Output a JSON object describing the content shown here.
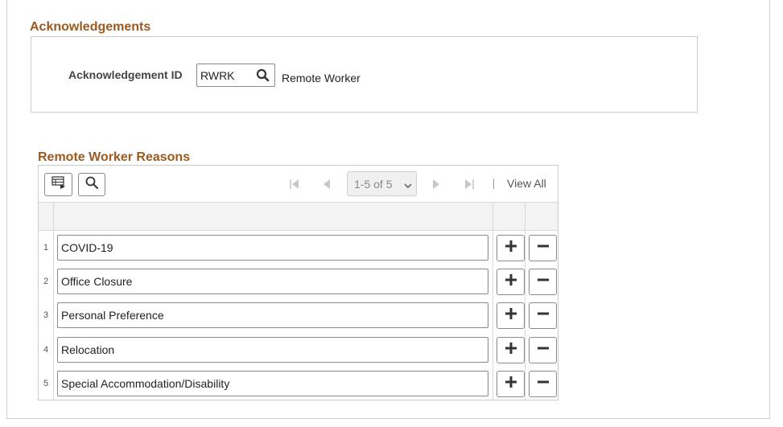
{
  "acknowledgements": {
    "section_title": "Acknowledgements",
    "id_label": "Acknowledgement ID",
    "id_value": "RWRK",
    "description": "Remote Worker"
  },
  "grid": {
    "title": "Remote Worker Reasons",
    "pagination": "1-5 of 5",
    "view_all": "View All",
    "rows": [
      {
        "num": "1",
        "value": "COVID-19"
      },
      {
        "num": "2",
        "value": "Office Closure"
      },
      {
        "num": "3",
        "value": "Personal Preference"
      },
      {
        "num": "4",
        "value": "Relocation"
      },
      {
        "num": "5",
        "value": "Special Accommodation/Disability"
      }
    ]
  },
  "colors": {
    "section_title": "#9c5a1f",
    "border": "#8a8a8a",
    "header_bg": "#f3f3f3"
  },
  "icons": {
    "lookup": "search-icon",
    "personalize": "grid-personalize-icon",
    "find": "search-icon",
    "first": "first-page-icon",
    "prev": "previous-page-icon",
    "next": "next-page-icon",
    "last": "last-page-icon",
    "add": "plus-icon",
    "delete": "minus-icon"
  }
}
